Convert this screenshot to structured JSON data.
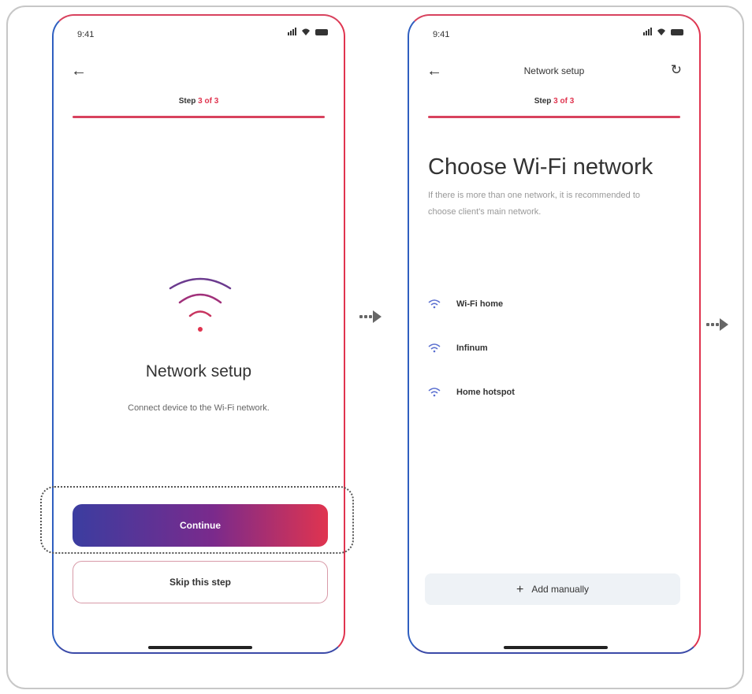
{
  "screen1": {
    "status_time": "9:41",
    "step_prefix": "Step ",
    "step_value": "3 of 3",
    "title": "Network setup",
    "subtitle": "Connect device to the Wi-Fi network.",
    "continue_label": "Continue",
    "skip_label": "Skip this step"
  },
  "screen2": {
    "status_time": "9:41",
    "nav_title": "Network setup",
    "step_prefix": "Step ",
    "step_value": "3 of 3",
    "title": "Choose Wi-Fi network",
    "subtitle": "If there is more than one network, it is recommended to choose client's main network.",
    "networks": [
      {
        "name": "Wi-Fi home"
      },
      {
        "name": "Infinum"
      },
      {
        "name": "Home hotspot"
      }
    ],
    "add_label": "Add manually",
    "add_icon": "+"
  },
  "icons": {
    "back": "back-arrow-icon",
    "refresh": "refresh-icon",
    "wifi": "wifi-icon"
  },
  "colors": {
    "accent_red": "#e0344f",
    "gradient_start": "#3b3da0",
    "gradient_end": "#e0344f",
    "wifi_icon_blue": "#5a6fd0",
    "wifi_icon_purple": "#6b3a8e",
    "add_button_bg": "#eef2f6"
  }
}
